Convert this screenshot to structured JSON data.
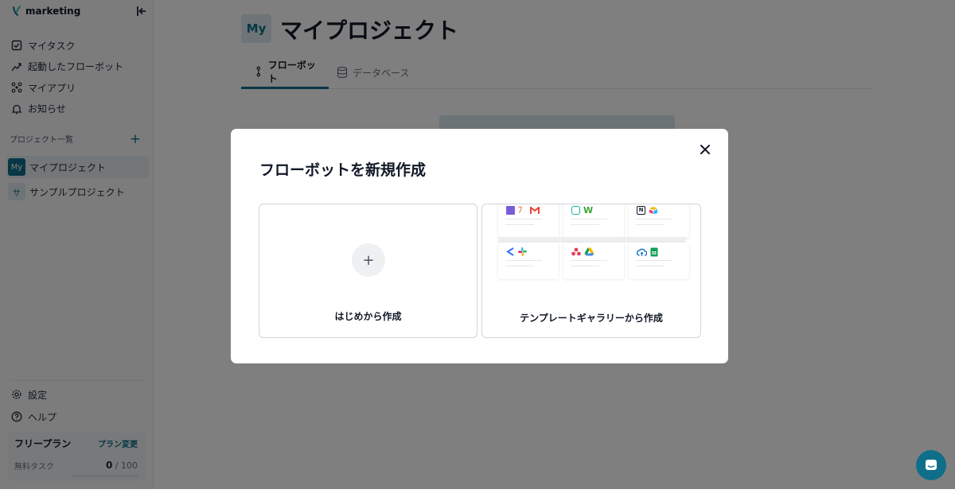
{
  "sidebar": {
    "brand": "marketing",
    "nav": [
      {
        "label": "マイタスク",
        "icon": "checkbox-icon"
      },
      {
        "label": "起動したフローボット",
        "icon": "flow-arrow-icon"
      },
      {
        "label": "マイアプリ",
        "icon": "apps-icon"
      },
      {
        "label": "お知らせ",
        "icon": "bell-icon"
      }
    ],
    "projects_header": "プロジェクト一覧",
    "projects": [
      {
        "badge": "My",
        "label": "マイプロジェクト",
        "active": true
      },
      {
        "badge": "サ",
        "label": "サンプルプロジェクト",
        "active": false
      }
    ],
    "bottom_nav": [
      {
        "label": "設定",
        "icon": "gear-icon"
      },
      {
        "label": "ヘルプ",
        "icon": "help-icon"
      }
    ],
    "plan": {
      "name": "フリープラン",
      "change_label": "プラン変更",
      "task_label": "無料タスク",
      "used": "0",
      "limit": "/ 100"
    }
  },
  "main": {
    "badge": "My",
    "title": "マイプロジェクト",
    "tabs": [
      {
        "label": "フローボット",
        "active": true
      },
      {
        "label": "データベース",
        "active": false
      }
    ]
  },
  "modal": {
    "title": "フローボットを新規作成",
    "options": [
      {
        "label": "はじめから作成"
      },
      {
        "label": "テンプレートギャラリーから作成"
      }
    ]
  },
  "colors": {
    "accent": "#0f6f8a",
    "overlay": "rgba(0,0,0,0.5)"
  }
}
